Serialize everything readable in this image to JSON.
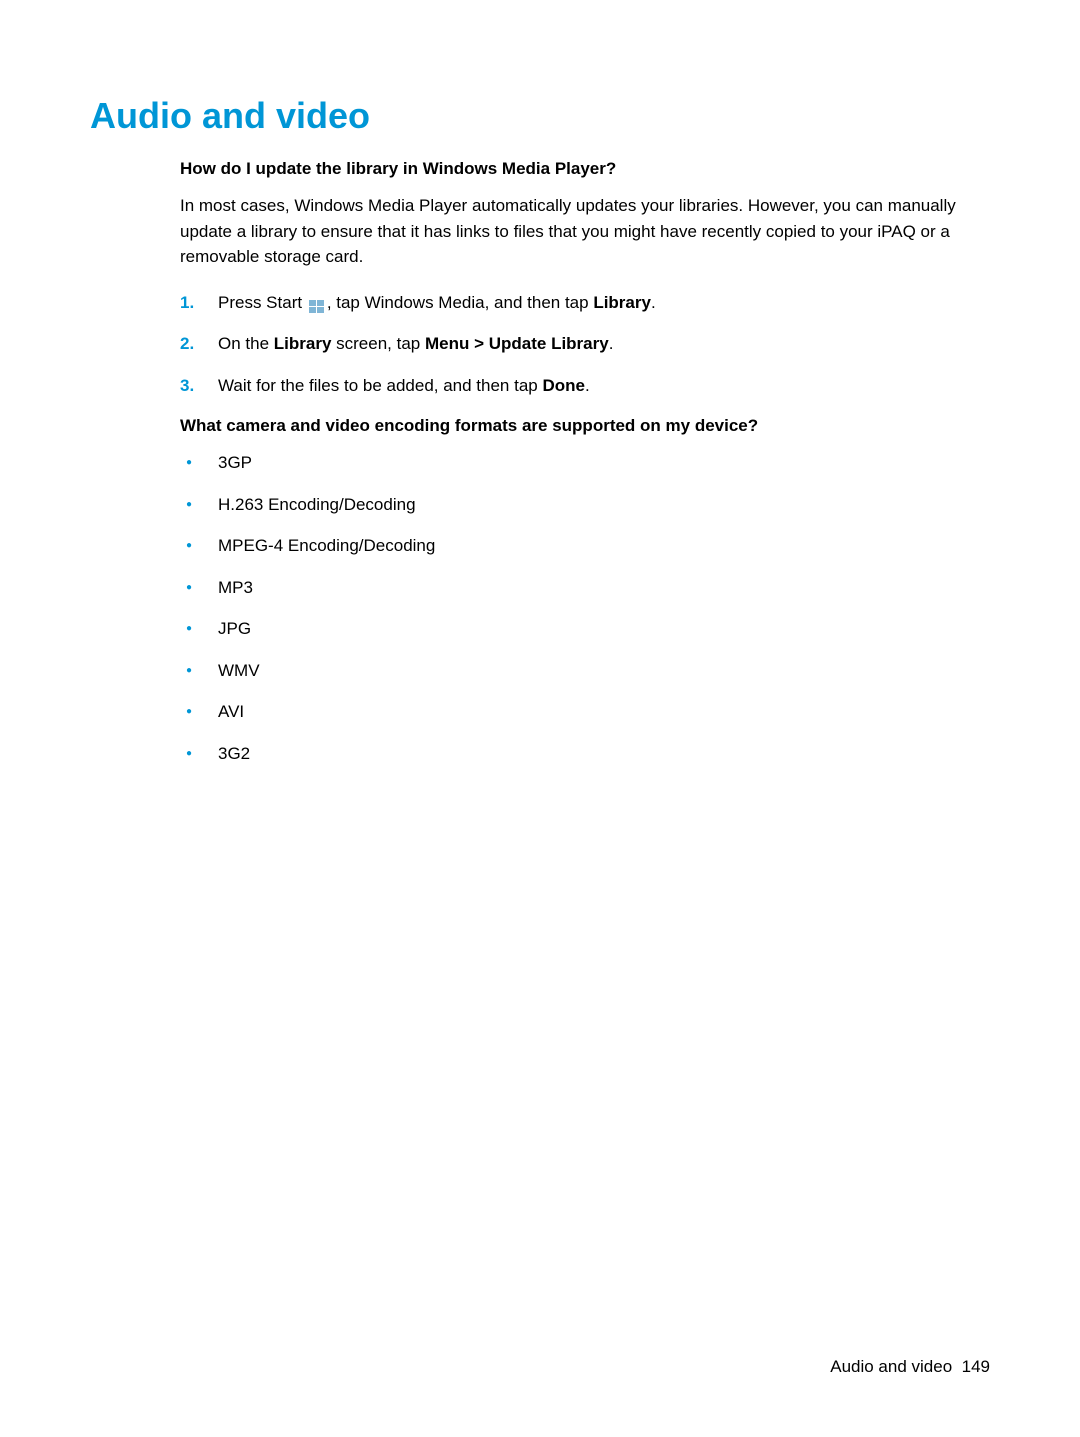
{
  "page_title": "Audio and video",
  "section1": {
    "heading": "How do I update the library in Windows Media Player?",
    "paragraph": "In most cases, Windows Media Player automatically updates your libraries. However, you can manually update a library to ensure that it has links to files that you might have recently copied to your iPAQ or a removable storage card.",
    "steps": [
      {
        "number": "1.",
        "text_before": "Press Start ",
        "text_after": ", tap Windows Media, and then tap ",
        "bold_text": "Library",
        "text_end": "."
      },
      {
        "number": "2.",
        "text_before": "On the ",
        "bold1": "Library",
        "text_mid": " screen, tap ",
        "bold2": "Menu > Update Library",
        "text_end": "."
      },
      {
        "number": "3.",
        "text_before": "Wait for the files to be added, and then tap ",
        "bold_text": "Done",
        "text_end": "."
      }
    ]
  },
  "section2": {
    "heading": "What camera and video encoding formats are supported on my device?",
    "formats": [
      "3GP",
      "H.263 Encoding/Decoding",
      "MPEG-4 Encoding/Decoding",
      "MP3",
      "JPG",
      "WMV",
      "AVI",
      "3G2"
    ]
  },
  "footer": {
    "section_name": "Audio and video",
    "page_number": "149"
  }
}
